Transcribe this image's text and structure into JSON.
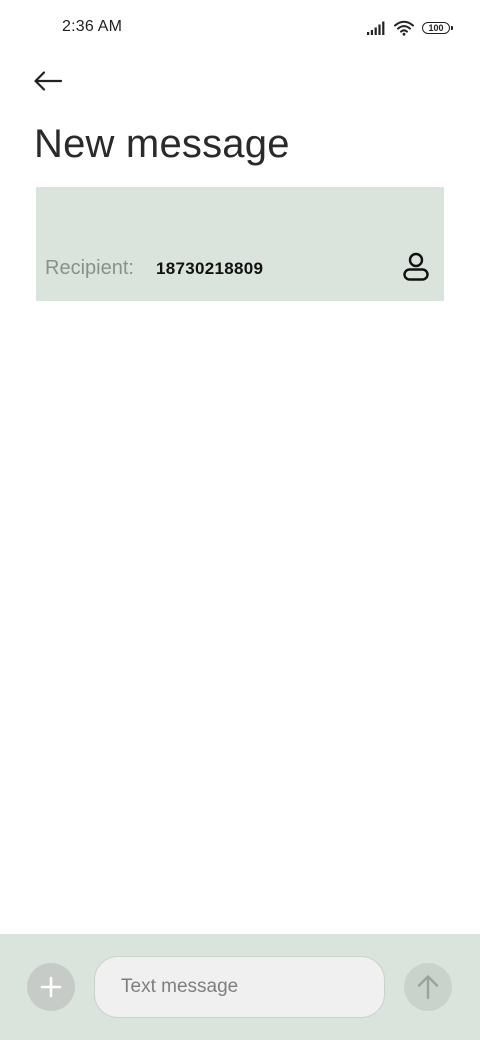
{
  "status_bar": {
    "time": "2:36 AM",
    "battery_level": "100",
    "icons": [
      "signal-icon",
      "wifi-icon",
      "battery-icon"
    ]
  },
  "header": {
    "back_icon": "back-arrow-icon",
    "title": "New message"
  },
  "recipient": {
    "label": "Recipient:",
    "value": "18730218809",
    "contact_icon": "person-icon"
  },
  "composer": {
    "attach_icon": "plus-icon",
    "placeholder": "Text message",
    "value": "",
    "send_icon": "arrow-up-icon"
  },
  "colors": {
    "panel_background": "#dae4dc",
    "attach_button": "#c7cbc8",
    "send_button": "#c9d2cb",
    "input_background": "#f0f0f0",
    "label_gray": "#8b908c"
  }
}
